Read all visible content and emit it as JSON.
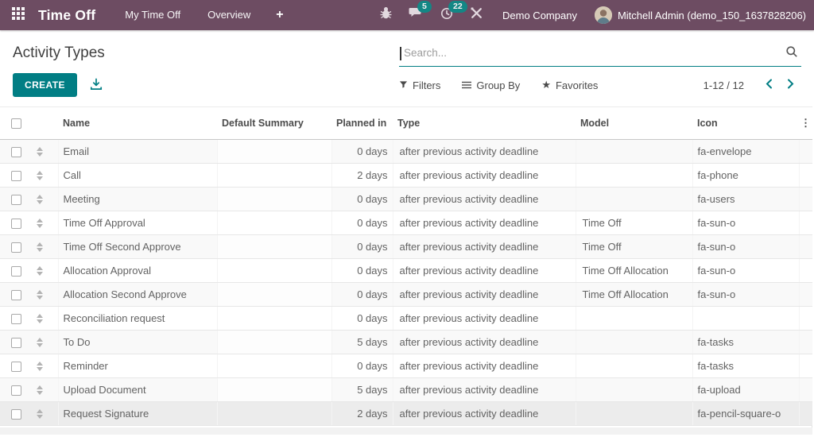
{
  "colors": {
    "navbar": "#6d4c62",
    "accent": "#017e84",
    "badge": "#0c8c88"
  },
  "navbar": {
    "app_name": "Time Off",
    "menu_items": [
      {
        "label": "My Time Off"
      },
      {
        "label": "Overview"
      }
    ],
    "plus_label": "+",
    "badges": {
      "messages": "5",
      "activities": "22"
    },
    "company": "Demo Company",
    "user": "Mitchell Admin (demo_150_1637828206)"
  },
  "control_panel": {
    "title": "Activity Types",
    "search_placeholder": "Search...",
    "create_label": "CREATE",
    "filters_label": "Filters",
    "group_by_label": "Group By",
    "favorites_label": "Favorites",
    "pager_text": "1-12 / 12"
  },
  "table": {
    "columns": [
      "Name",
      "Default Summary",
      "Planned in",
      "Type",
      "Model",
      "Icon"
    ],
    "rows": [
      {
        "name": "Email",
        "summary": "",
        "planned": "0 days",
        "type": "after previous activity deadline",
        "model": "",
        "icon": "fa-envelope"
      },
      {
        "name": "Call",
        "summary": "",
        "planned": "2 days",
        "type": "after previous activity deadline",
        "model": "",
        "icon": "fa-phone"
      },
      {
        "name": "Meeting",
        "summary": "",
        "planned": "0 days",
        "type": "after previous activity deadline",
        "model": "",
        "icon": "fa-users"
      },
      {
        "name": "Time Off Approval",
        "summary": "",
        "planned": "0 days",
        "type": "after previous activity deadline",
        "model": "Time Off",
        "icon": "fa-sun-o"
      },
      {
        "name": "Time Off Second Approve",
        "summary": "",
        "planned": "0 days",
        "type": "after previous activity deadline",
        "model": "Time Off",
        "icon": "fa-sun-o"
      },
      {
        "name": "Allocation Approval",
        "summary": "",
        "planned": "0 days",
        "type": "after previous activity deadline",
        "model": "Time Off Allocation",
        "icon": "fa-sun-o"
      },
      {
        "name": "Allocation Second Approve",
        "summary": "",
        "planned": "0 days",
        "type": "after previous activity deadline",
        "model": "Time Off Allocation",
        "icon": "fa-sun-o"
      },
      {
        "name": "Reconciliation request",
        "summary": "",
        "planned": "0 days",
        "type": "after previous activity deadline",
        "model": "",
        "icon": ""
      },
      {
        "name": "To Do",
        "summary": "",
        "planned": "5 days",
        "type": "after previous activity deadline",
        "model": "",
        "icon": "fa-tasks"
      },
      {
        "name": "Reminder",
        "summary": "",
        "planned": "0 days",
        "type": "after previous activity deadline",
        "model": "",
        "icon": "fa-tasks"
      },
      {
        "name": "Upload Document",
        "summary": "",
        "planned": "5 days",
        "type": "after previous activity deadline",
        "model": "",
        "icon": "fa-upload"
      },
      {
        "name": "Request Signature",
        "summary": "",
        "planned": "2 days",
        "type": "after previous activity deadline",
        "model": "",
        "icon": "fa-pencil-square-o",
        "highlighted": true
      }
    ]
  }
}
